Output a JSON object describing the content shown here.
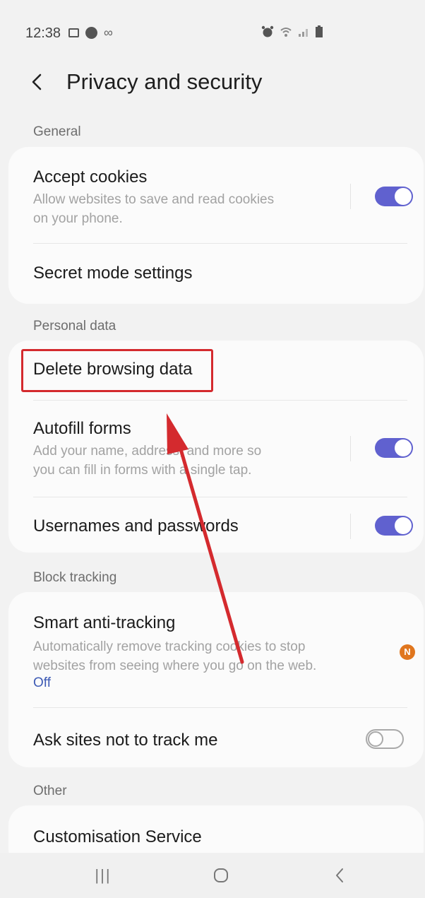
{
  "status_bar": {
    "time": "12:38",
    "link_glyph": "∞",
    "icons": [
      "gallery-icon",
      "circle-app-icon",
      "link-icon",
      "alarm-icon",
      "wifi-icon",
      "signal-icon",
      "battery-icon"
    ]
  },
  "header": {
    "back_glyph": "<",
    "title": "Privacy and security"
  },
  "sections": {
    "general": "General",
    "personal_data": "Personal data",
    "block_tracking": "Block tracking",
    "other": "Other"
  },
  "general": {
    "accept_cookies": {
      "title": "Accept cookies",
      "subtitle_line1": "Allow websites to save and read cookies",
      "subtitle_line2": "on your phone.",
      "enabled": true
    },
    "secret_mode": {
      "title": "Secret mode settings"
    }
  },
  "personal_data": {
    "delete_browsing": {
      "title": "Delete browsing data"
    },
    "autofill": {
      "title": "Autofill forms",
      "subtitle_line1": "Add your name, address, and more so",
      "subtitle_line2": "you can fill in forms with a single tap.",
      "enabled": true
    },
    "usernames": {
      "title": "Usernames and passwords",
      "enabled": true
    }
  },
  "block_tracking": {
    "smart_anti_tracking": {
      "title": "Smart anti-tracking",
      "subtitle_line1": "Automatically remove tracking cookies to stop",
      "subtitle_line2": "websites from seeing where you go on the web.",
      "status": "Off",
      "badge": "N"
    },
    "ask_not_track": {
      "title": "Ask sites not to track me",
      "enabled": false
    }
  },
  "other": {
    "customisation": {
      "title": "Customisation Service"
    }
  },
  "nav": {
    "recents_glyph": "|||",
    "back_glyph": "<"
  },
  "colors": {
    "accent": "#6061cf",
    "highlight": "#d42a2e",
    "badge": "#e0761e",
    "status_text": "#3e5bb5"
  }
}
